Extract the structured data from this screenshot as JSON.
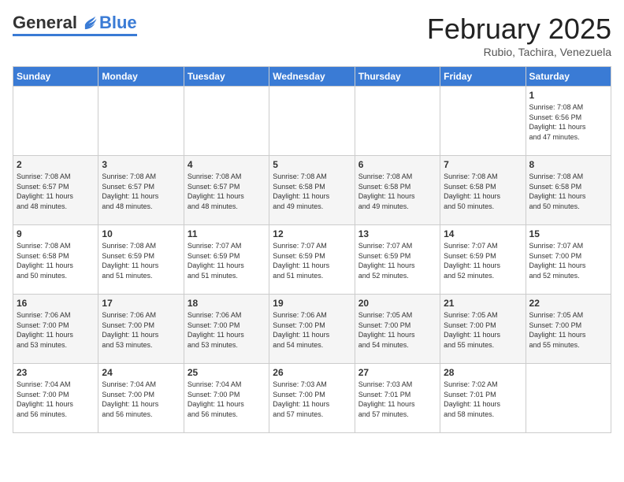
{
  "header": {
    "logo": {
      "general": "General",
      "blue": "Blue"
    },
    "title": "February 2025",
    "location": "Rubio, Tachira, Venezuela"
  },
  "calendar": {
    "days_of_week": [
      "Sunday",
      "Monday",
      "Tuesday",
      "Wednesday",
      "Thursday",
      "Friday",
      "Saturday"
    ],
    "weeks": [
      [
        {
          "day": "",
          "info": ""
        },
        {
          "day": "",
          "info": ""
        },
        {
          "day": "",
          "info": ""
        },
        {
          "day": "",
          "info": ""
        },
        {
          "day": "",
          "info": ""
        },
        {
          "day": "",
          "info": ""
        },
        {
          "day": "1",
          "info": "Sunrise: 7:08 AM\nSunset: 6:56 PM\nDaylight: 11 hours\nand 47 minutes."
        }
      ],
      [
        {
          "day": "2",
          "info": "Sunrise: 7:08 AM\nSunset: 6:57 PM\nDaylight: 11 hours\nand 48 minutes."
        },
        {
          "day": "3",
          "info": "Sunrise: 7:08 AM\nSunset: 6:57 PM\nDaylight: 11 hours\nand 48 minutes."
        },
        {
          "day": "4",
          "info": "Sunrise: 7:08 AM\nSunset: 6:57 PM\nDaylight: 11 hours\nand 48 minutes."
        },
        {
          "day": "5",
          "info": "Sunrise: 7:08 AM\nSunset: 6:58 PM\nDaylight: 11 hours\nand 49 minutes."
        },
        {
          "day": "6",
          "info": "Sunrise: 7:08 AM\nSunset: 6:58 PM\nDaylight: 11 hours\nand 49 minutes."
        },
        {
          "day": "7",
          "info": "Sunrise: 7:08 AM\nSunset: 6:58 PM\nDaylight: 11 hours\nand 50 minutes."
        },
        {
          "day": "8",
          "info": "Sunrise: 7:08 AM\nSunset: 6:58 PM\nDaylight: 11 hours\nand 50 minutes."
        }
      ],
      [
        {
          "day": "9",
          "info": "Sunrise: 7:08 AM\nSunset: 6:58 PM\nDaylight: 11 hours\nand 50 minutes."
        },
        {
          "day": "10",
          "info": "Sunrise: 7:08 AM\nSunset: 6:59 PM\nDaylight: 11 hours\nand 51 minutes."
        },
        {
          "day": "11",
          "info": "Sunrise: 7:07 AM\nSunset: 6:59 PM\nDaylight: 11 hours\nand 51 minutes."
        },
        {
          "day": "12",
          "info": "Sunrise: 7:07 AM\nSunset: 6:59 PM\nDaylight: 11 hours\nand 51 minutes."
        },
        {
          "day": "13",
          "info": "Sunrise: 7:07 AM\nSunset: 6:59 PM\nDaylight: 11 hours\nand 52 minutes."
        },
        {
          "day": "14",
          "info": "Sunrise: 7:07 AM\nSunset: 6:59 PM\nDaylight: 11 hours\nand 52 minutes."
        },
        {
          "day": "15",
          "info": "Sunrise: 7:07 AM\nSunset: 7:00 PM\nDaylight: 11 hours\nand 52 minutes."
        }
      ],
      [
        {
          "day": "16",
          "info": "Sunrise: 7:06 AM\nSunset: 7:00 PM\nDaylight: 11 hours\nand 53 minutes."
        },
        {
          "day": "17",
          "info": "Sunrise: 7:06 AM\nSunset: 7:00 PM\nDaylight: 11 hours\nand 53 minutes."
        },
        {
          "day": "18",
          "info": "Sunrise: 7:06 AM\nSunset: 7:00 PM\nDaylight: 11 hours\nand 53 minutes."
        },
        {
          "day": "19",
          "info": "Sunrise: 7:06 AM\nSunset: 7:00 PM\nDaylight: 11 hours\nand 54 minutes."
        },
        {
          "day": "20",
          "info": "Sunrise: 7:05 AM\nSunset: 7:00 PM\nDaylight: 11 hours\nand 54 minutes."
        },
        {
          "day": "21",
          "info": "Sunrise: 7:05 AM\nSunset: 7:00 PM\nDaylight: 11 hours\nand 55 minutes."
        },
        {
          "day": "22",
          "info": "Sunrise: 7:05 AM\nSunset: 7:00 PM\nDaylight: 11 hours\nand 55 minutes."
        }
      ],
      [
        {
          "day": "23",
          "info": "Sunrise: 7:04 AM\nSunset: 7:00 PM\nDaylight: 11 hours\nand 56 minutes."
        },
        {
          "day": "24",
          "info": "Sunrise: 7:04 AM\nSunset: 7:00 PM\nDaylight: 11 hours\nand 56 minutes."
        },
        {
          "day": "25",
          "info": "Sunrise: 7:04 AM\nSunset: 7:00 PM\nDaylight: 11 hours\nand 56 minutes."
        },
        {
          "day": "26",
          "info": "Sunrise: 7:03 AM\nSunset: 7:00 PM\nDaylight: 11 hours\nand 57 minutes."
        },
        {
          "day": "27",
          "info": "Sunrise: 7:03 AM\nSunset: 7:01 PM\nDaylight: 11 hours\nand 57 minutes."
        },
        {
          "day": "28",
          "info": "Sunrise: 7:02 AM\nSunset: 7:01 PM\nDaylight: 11 hours\nand 58 minutes."
        },
        {
          "day": "",
          "info": ""
        }
      ]
    ]
  }
}
